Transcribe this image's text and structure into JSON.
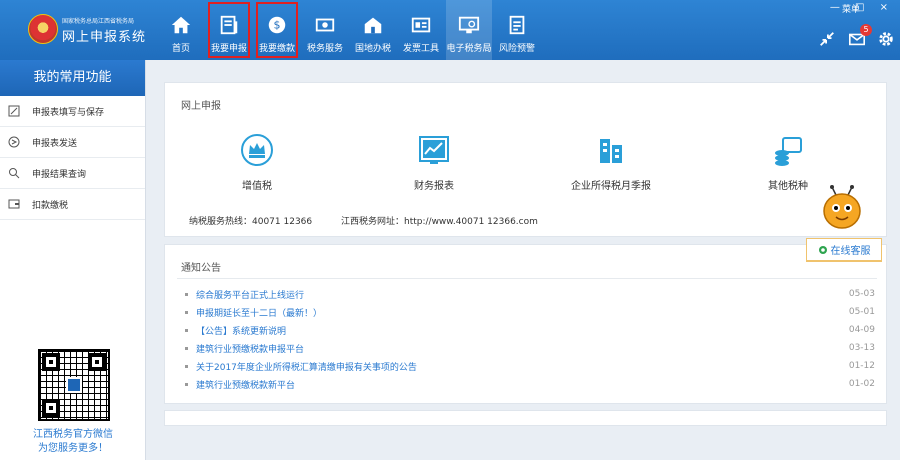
{
  "header": {
    "logo_sub": "国家税务总局江西省税务局",
    "logo_main": "网上申报系统",
    "user_label": "菜单",
    "window_controls": "— □ ×",
    "mail_badge": "5"
  },
  "nav": [
    {
      "label": "首页",
      "icon": "home-icon"
    },
    {
      "label": "我要申报",
      "icon": "document-icon"
    },
    {
      "label": "我要缴款",
      "icon": "coin-icon"
    },
    {
      "label": "税务服务",
      "icon": "money-icon"
    },
    {
      "label": "国地办税",
      "icon": "house-icon"
    },
    {
      "label": "发票工具",
      "icon": "tools-icon"
    },
    {
      "label": "电子税务局",
      "icon": "monitor-icon"
    },
    {
      "label": "风险预警",
      "icon": "clipboard-icon"
    }
  ],
  "sidebar": {
    "title": "我的常用功能",
    "items": [
      {
        "label": "申报表填写与保存",
        "icon": "edit-icon"
      },
      {
        "label": "申报表发送",
        "icon": "send-icon"
      },
      {
        "label": "申报结果查询",
        "icon": "search-icon"
      },
      {
        "label": "扣款缴税",
        "icon": "wallet-icon"
      }
    ],
    "qr_text_1": "江西税务官方微信",
    "qr_text_2": "为您服务更多！"
  },
  "declare_panel": {
    "title": "网上申报",
    "items": [
      {
        "label": "增值税",
        "icon": "crown-icon"
      },
      {
        "label": "财务报表",
        "icon": "chart-icon"
      },
      {
        "label": "企业所得税月季报",
        "icon": "building-icon"
      },
      {
        "label": "其他税种",
        "icon": "coins-icon"
      }
    ],
    "hotline": "纳税服务热线：40071 12366",
    "website": "江西税务网址：http://www.40071 12366.com"
  },
  "notice_panel": {
    "title": "通知公告",
    "items": [
      {
        "title": "综合服务平台正式上线运行",
        "date": "05-03"
      },
      {
        "title": "申报期延长至十二日（最新！）",
        "date": "05-01"
      },
      {
        "title": "【公告】系统更新说明",
        "date": "04-09"
      },
      {
        "title": "建筑行业预缴税款申报平台",
        "date": "03-13"
      },
      {
        "title": "关于2017年度企业所得税汇算清缴申报有关事项的公告",
        "date": "01-12"
      },
      {
        "title": "建筑行业预缴税款新平台",
        "date": "01-02"
      }
    ]
  },
  "online_service": "在线客服",
  "colors": {
    "header": "#2277c8",
    "accent": "#2a7ad0",
    "highlight_box": "#e02020"
  }
}
